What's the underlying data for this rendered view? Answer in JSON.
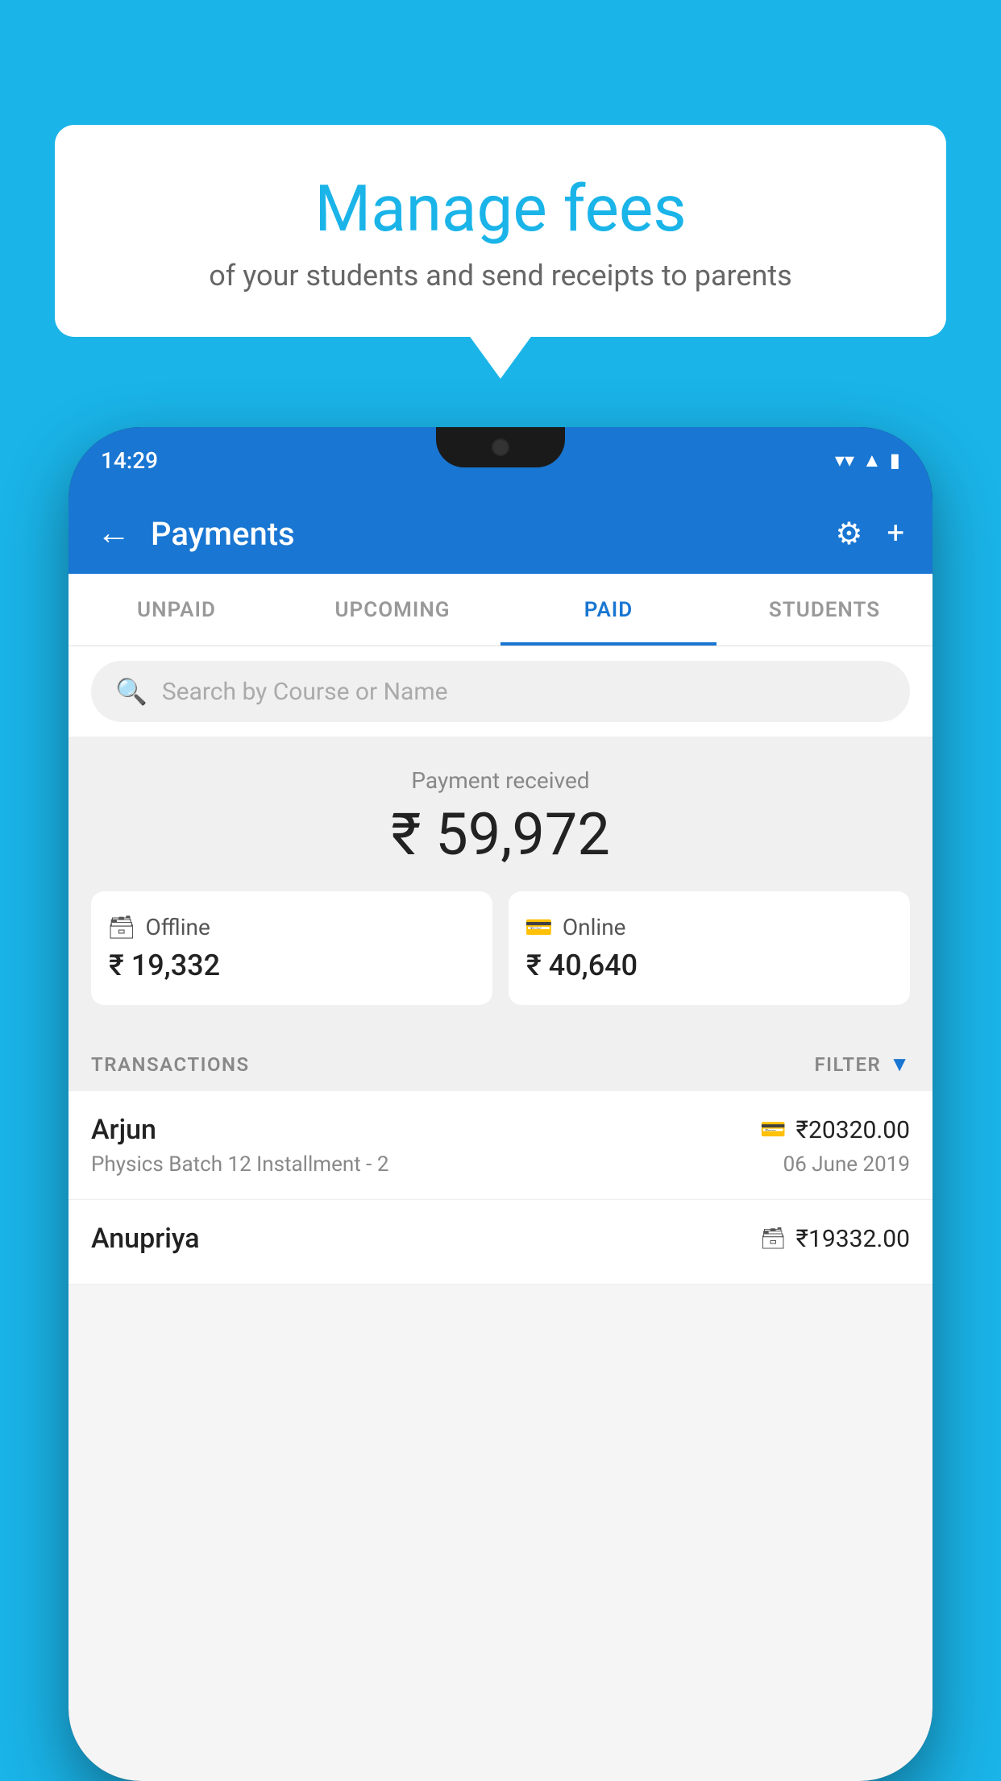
{
  "background_color": "#1ab4e8",
  "bubble": {
    "title": "Manage fees",
    "subtitle": "of your students and send receipts to parents"
  },
  "status_bar": {
    "time": "14:29"
  },
  "header": {
    "title": "Payments",
    "back_label": "←"
  },
  "tabs": [
    {
      "id": "unpaid",
      "label": "UNPAID",
      "active": false
    },
    {
      "id": "upcoming",
      "label": "UPCOMING",
      "active": false
    },
    {
      "id": "paid",
      "label": "PAID",
      "active": true
    },
    {
      "id": "students",
      "label": "STUDENTS",
      "active": false
    }
  ],
  "search": {
    "placeholder": "Search by Course or Name"
  },
  "payment_received": {
    "label": "Payment received",
    "total": "₹ 59,972",
    "offline": {
      "label": "Offline",
      "amount": "₹ 19,332"
    },
    "online": {
      "label": "Online",
      "amount": "₹ 40,640"
    }
  },
  "transactions": {
    "header_label": "TRANSACTIONS",
    "filter_label": "FILTER",
    "items": [
      {
        "name": "Arjun",
        "course": "Physics Batch 12 Installment - 2",
        "amount": "₹20320.00",
        "date": "06 June 2019",
        "payment_type": "card"
      },
      {
        "name": "Anupriya",
        "course": "",
        "amount": "₹19332.00",
        "date": "",
        "payment_type": "offline"
      }
    ]
  }
}
